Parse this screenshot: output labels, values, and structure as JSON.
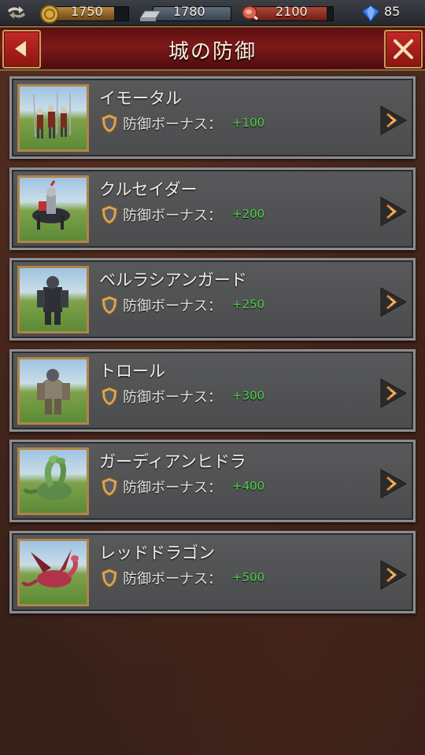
{
  "resources": {
    "gold": "1750",
    "iron": "1780",
    "food": "2100",
    "gems": "85",
    "gold_fill": 0.82,
    "food_fill": 0.92
  },
  "header": {
    "title": "城の防御"
  },
  "bonus_label": "防御ボーナス：",
  "units": [
    {
      "name": "イモータル",
      "bonus": "+100",
      "art": "immortal"
    },
    {
      "name": "クルセイダー",
      "bonus": "+200",
      "art": "crusader"
    },
    {
      "name": "ベルラシアンガード",
      "bonus": "+250",
      "art": "guard"
    },
    {
      "name": "トロール",
      "bonus": "+300",
      "art": "troll"
    },
    {
      "name": "ガーディアンヒドラ",
      "bonus": "+400",
      "art": "hydra"
    },
    {
      "name": "レッドドラゴン",
      "bonus": "+500",
      "art": "dragon"
    }
  ],
  "colors": {
    "bonus_green": "#4ed04a",
    "title_red": "#7e1a1a",
    "frame_gold": "#b08547"
  }
}
